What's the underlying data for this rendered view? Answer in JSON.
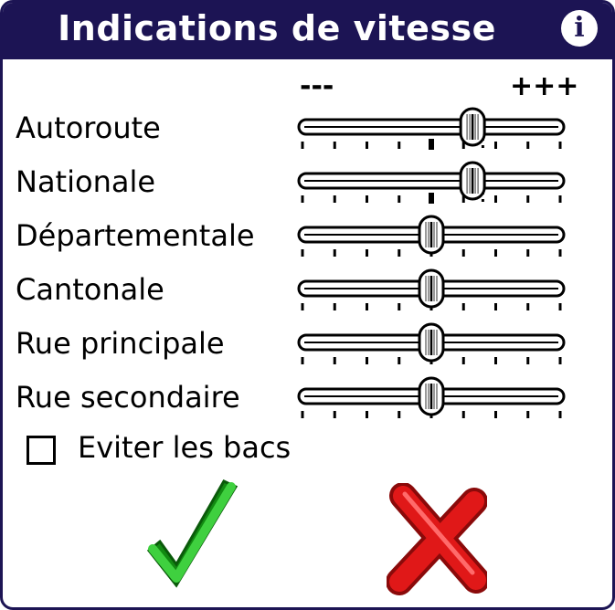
{
  "window": {
    "title": "Indications de vitesse",
    "info_icon": "info-icon"
  },
  "scale": {
    "min_label": "---",
    "max_label": "+++"
  },
  "sliders": [
    {
      "label": "Autoroute",
      "value": 0.66,
      "ticks": 9,
      "marker": 0.5,
      "dots": [
        0.7
      ]
    },
    {
      "label": "Nationale",
      "value": 0.66,
      "ticks": 9,
      "marker": 0.5,
      "dots": [
        0.7
      ]
    },
    {
      "label": "Départementale",
      "value": 0.5,
      "ticks": 9,
      "marker": null,
      "dots": []
    },
    {
      "label": "Cantonale",
      "value": 0.5,
      "ticks": 9,
      "marker": null,
      "dots": []
    },
    {
      "label": "Rue principale",
      "value": 0.5,
      "ticks": 9,
      "marker": null,
      "dots": []
    },
    {
      "label": "Rue secondaire",
      "value": 0.5,
      "ticks": 9,
      "marker": null,
      "dots": []
    }
  ],
  "options": {
    "avoid_ferries_label": "Eviter les bacs",
    "avoid_ferries_checked": false
  },
  "buttons": {
    "ok_icon": "checkmark-icon",
    "cancel_icon": "cross-icon"
  },
  "colors": {
    "titlebar": "#1c1454",
    "ok": "#1fa81f",
    "cancel": "#d41212"
  }
}
